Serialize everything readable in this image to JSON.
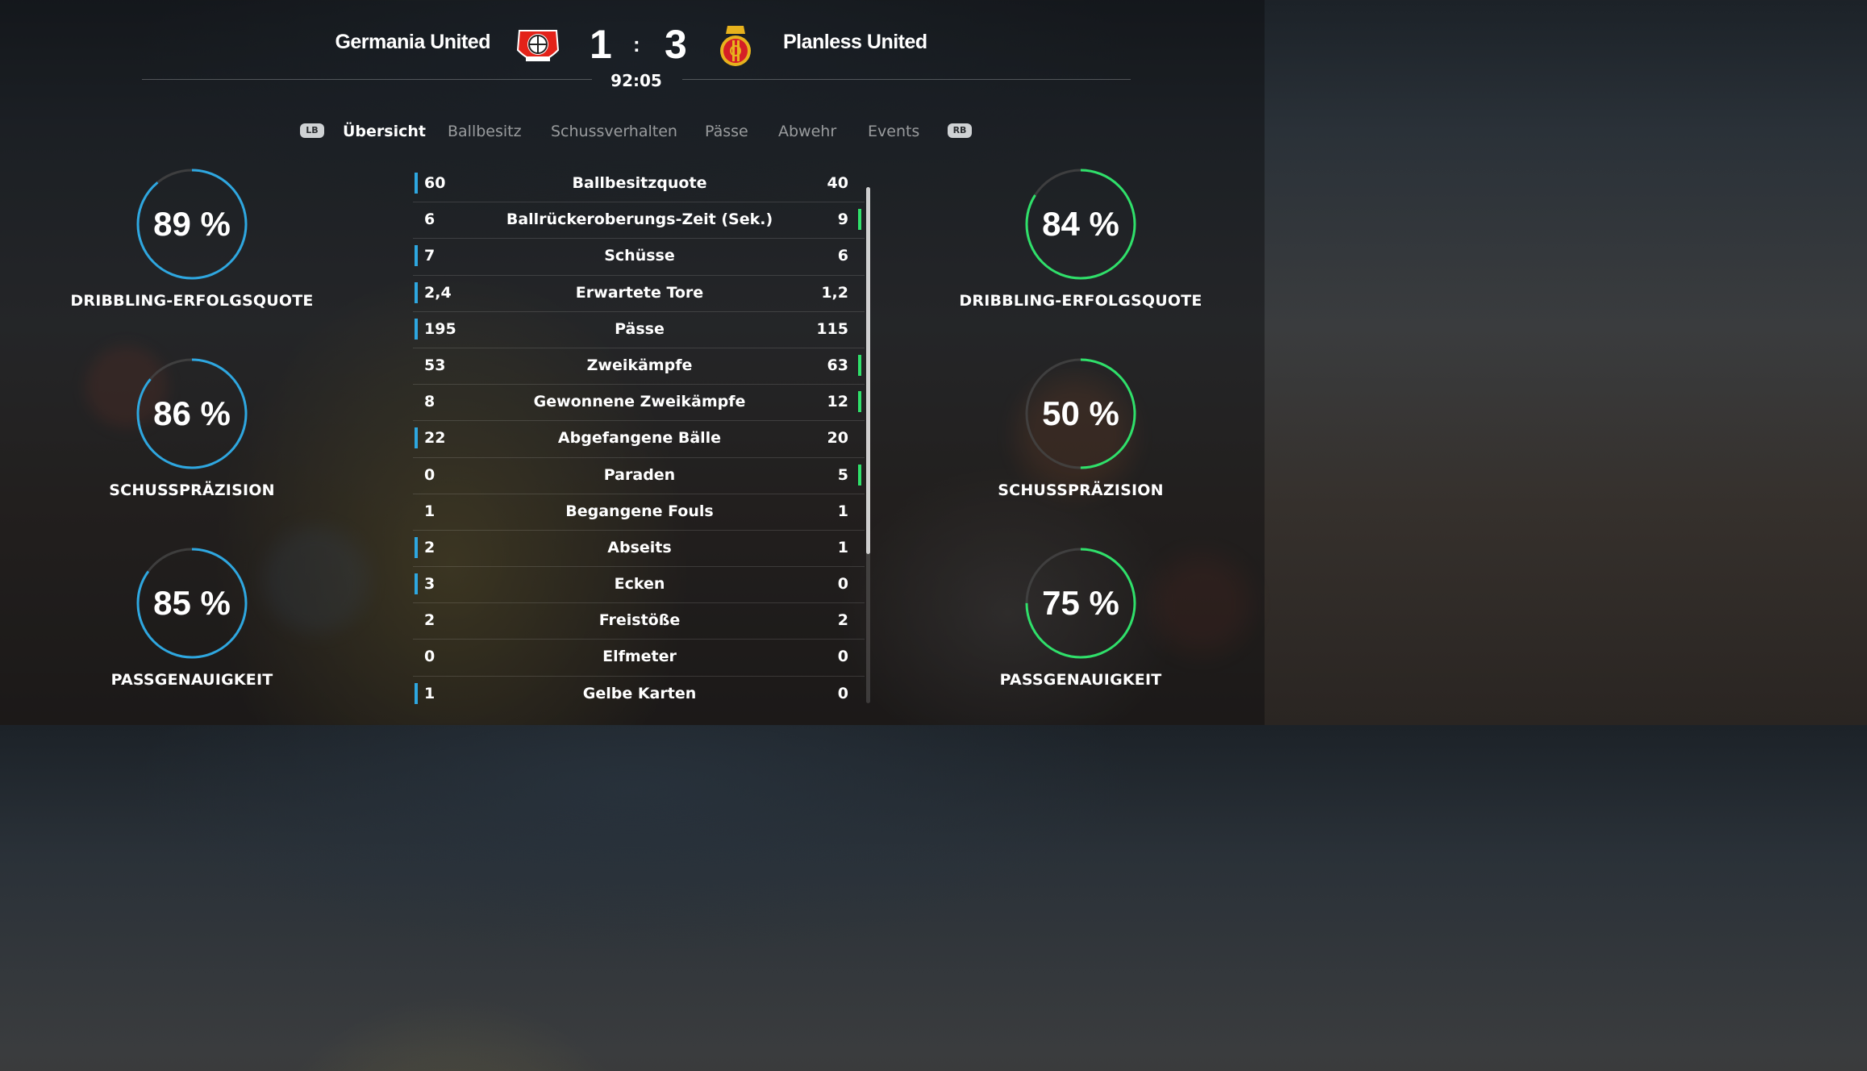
{
  "match": {
    "home_team": "Germania United",
    "away_team": "Planless United",
    "home_score": "1",
    "separator": ":",
    "away_score": "3",
    "clock": "92:05",
    "home_color": "#2ea7e0",
    "away_color": "#2fe06a"
  },
  "tabs": {
    "lb": "LB",
    "rb": "RB",
    "items": [
      "Übersicht",
      "Ballbesitz",
      "Schussverhalten",
      "Pässe",
      "Abwehr",
      "Events"
    ],
    "active": "Übersicht"
  },
  "home_rings": [
    {
      "value": "89 %",
      "percent": 89,
      "label": "DRIBBLING-ERFOLGSQUOTE"
    },
    {
      "value": "86 %",
      "percent": 86,
      "label": "SCHUSSPRÄZISION"
    },
    {
      "value": "85 %",
      "percent": 85,
      "label": "PASSGENAUIGKEIT"
    }
  ],
  "away_rings": [
    {
      "value": "84 %",
      "percent": 84,
      "label": "DRIBBLING-ERFOLGSQUOTE"
    },
    {
      "value": "50 %",
      "percent": 50,
      "label": "SCHUSSPRÄZISION"
    },
    {
      "value": "75 %",
      "percent": 75,
      "label": "PASSGENAUIGKEIT"
    }
  ],
  "stats": [
    {
      "label": "Ballbesitzquote",
      "home": "60",
      "away": "40",
      "leader": "home"
    },
    {
      "label": "Ballrückeroberungs-Zeit (Sek.)",
      "home": "6",
      "away": "9",
      "leader": "away"
    },
    {
      "label": "Schüsse",
      "home": "7",
      "away": "6",
      "leader": "home"
    },
    {
      "label": "Erwartete Tore",
      "home": "2,4",
      "away": "1,2",
      "leader": "home"
    },
    {
      "label": "Pässe",
      "home": "195",
      "away": "115",
      "leader": "home"
    },
    {
      "label": "Zweikämpfe",
      "home": "53",
      "away": "63",
      "leader": "away"
    },
    {
      "label": "Gewonnene Zweikämpfe",
      "home": "8",
      "away": "12",
      "leader": "away"
    },
    {
      "label": "Abgefangene Bälle",
      "home": "22",
      "away": "20",
      "leader": "home"
    },
    {
      "label": "Paraden",
      "home": "0",
      "away": "5",
      "leader": "away"
    },
    {
      "label": "Begangene Fouls",
      "home": "1",
      "away": "1",
      "leader": "none"
    },
    {
      "label": "Abseits",
      "home": "2",
      "away": "1",
      "leader": "home"
    },
    {
      "label": "Ecken",
      "home": "3",
      "away": "0",
      "leader": "home"
    },
    {
      "label": "Freistöße",
      "home": "2",
      "away": "2",
      "leader": "none"
    },
    {
      "label": "Elfmeter",
      "home": "0",
      "away": "0",
      "leader": "none"
    },
    {
      "label": "Gelbe Karten",
      "home": "1",
      "away": "0",
      "leader": "home"
    }
  ],
  "icons": {
    "home_crest": "home-club-crest-icon",
    "away_crest": "away-club-crest-icon"
  }
}
